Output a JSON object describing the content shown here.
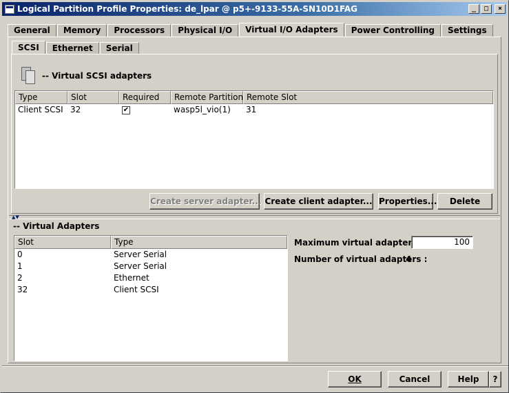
{
  "window": {
    "title": "Logical Partition Profile Properties: de_lpar @ p5+-9133-55A-SN10D1FAG"
  },
  "outer_tabs": [
    "General",
    "Memory",
    "Processors",
    "Physical I/O",
    "Virtual I/O Adapters",
    "Power Controlling",
    "Settings"
  ],
  "inner_tabs": [
    "SCSI",
    "Ethernet",
    "Serial"
  ],
  "scsi": {
    "heading": "-- Virtual SCSI adapters",
    "columns": [
      "Type",
      "Slot",
      "Required",
      "Remote Partition",
      "Remote Slot"
    ],
    "rows": [
      {
        "type": "Client SCSI",
        "slot": "32",
        "required": "✔",
        "remote_partition": "wasp5l_vio(1)",
        "remote_slot": "31"
      }
    ],
    "buttons": {
      "create_server": "Create server adapter...",
      "create_client": "Create client adapter...",
      "properties": "Properties...",
      "delete": "Delete"
    }
  },
  "virtual_adapters": {
    "heading": "-- Virtual Adapters",
    "columns": [
      "Slot",
      "Type"
    ],
    "rows": [
      {
        "slot": "0",
        "type": "Server Serial"
      },
      {
        "slot": "1",
        "type": "Server Serial"
      },
      {
        "slot": "2",
        "type": "Ethernet"
      },
      {
        "slot": "32",
        "type": "Client SCSI"
      }
    ],
    "max_label": "Maximum virtual adapters :",
    "max_value": "100",
    "count_label": "Number of virtual adapters :",
    "count_value": "4"
  },
  "footer": {
    "ok": "OK",
    "cancel": "Cancel",
    "help": "Help",
    "question": "?"
  }
}
